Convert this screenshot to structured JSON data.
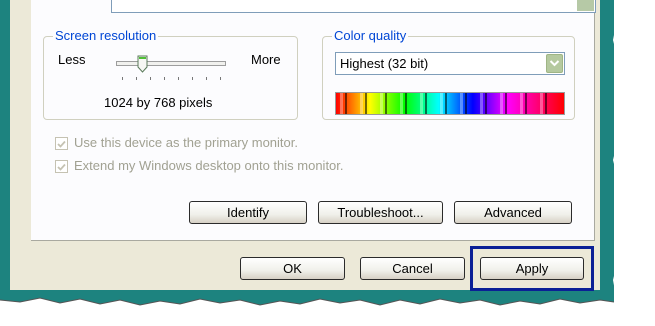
{
  "screen_resolution": {
    "legend": "Screen resolution",
    "less_label": "Less",
    "more_label": "More",
    "value_text": "1024 by 768 pixels",
    "slider_level": 0.25
  },
  "color_quality": {
    "legend": "Color quality",
    "selected": "Highest (32 bit)"
  },
  "options": {
    "primary_monitor": "Use this device as the primary monitor.",
    "extend_desktop": "Extend my Windows desktop onto this monitor."
  },
  "buttons": {
    "identify": "Identify",
    "troubleshoot": "Troubleshoot...",
    "advanced": "Advanced",
    "ok": "OK",
    "cancel": "Cancel",
    "apply": "Apply"
  },
  "colors": {
    "legend_text": "#0046d5",
    "highlight_border": "#0b2096",
    "background_teal": "#1d837f"
  }
}
